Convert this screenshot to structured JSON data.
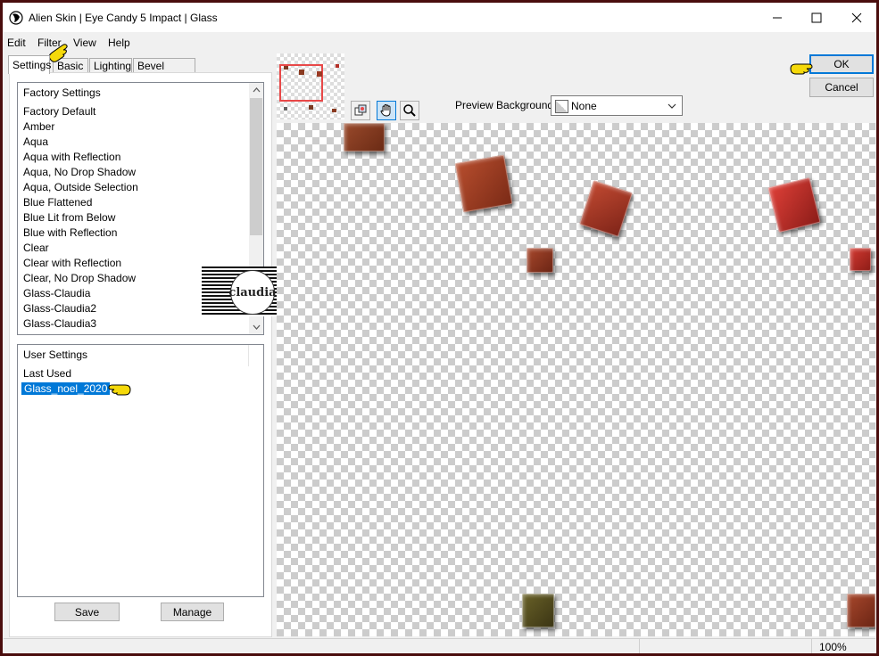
{
  "window": {
    "title": "Alien Skin | Eye Candy 5 Impact | Glass",
    "minimize_icon": "minimize-icon",
    "maximize_icon": "maximize-icon",
    "close_icon": "close-icon"
  },
  "menu": [
    "Edit",
    "Filter",
    "View",
    "Help"
  ],
  "tabs": [
    "Settings",
    "Basic",
    "Lighting",
    "Bevel Profile"
  ],
  "factory": {
    "header": "Factory Settings",
    "items": [
      "Factory Default",
      "Amber",
      "Aqua",
      "Aqua with Reflection",
      "Aqua, No Drop Shadow",
      "Aqua, Outside Selection",
      "Blue Flattened",
      "Blue Lit from Below",
      "Blue with Reflection",
      "Clear",
      "Clear with Reflection",
      "Clear, No Drop Shadow",
      "Glass-Claudia",
      "Glass-Claudia2",
      "Glass-Claudia3"
    ]
  },
  "user": {
    "header": "User Settings",
    "items": [
      "Last Used",
      "Glass_noel_2020"
    ],
    "selected": "Glass_noel_2020"
  },
  "buttons": {
    "save": "Save",
    "manage": "Manage",
    "ok": "OK",
    "cancel": "Cancel"
  },
  "preview_background": {
    "label": "Preview Background:",
    "value": "None"
  },
  "tools": [
    "pan-view-icon",
    "hand-icon",
    "zoom-icon"
  ],
  "watermark": "claudia",
  "status": {
    "zoom": "100%"
  },
  "colors": {
    "accent": "#0078d7",
    "frame": "#4a0d0d",
    "pointer": "#f5d90a"
  }
}
